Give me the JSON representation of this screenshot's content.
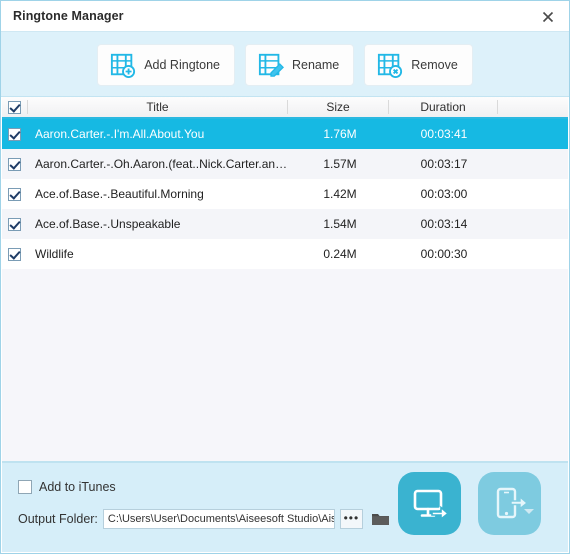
{
  "window": {
    "title": "Ringtone Manager",
    "close_icon": "close-icon"
  },
  "toolbar": {
    "buttons": [
      {
        "label": "Add Ringtone",
        "icon": "film-add-icon"
      },
      {
        "label": "Rename",
        "icon": "film-pencil-icon"
      },
      {
        "label": "Remove",
        "icon": "film-remove-icon"
      }
    ]
  },
  "table": {
    "select_all_checked": true,
    "headers": {
      "title": "Title",
      "size": "Size",
      "duration": "Duration"
    },
    "rows": [
      {
        "checked": true,
        "title": "Aaron.Carter.-.I'm.All.About.You",
        "size": "1.76M",
        "duration": "00:03:41",
        "selected": true
      },
      {
        "checked": true,
        "title": "Aaron.Carter.-.Oh.Aaron.(feat..Nick.Carter.and.No.Sec...",
        "size": "1.57M",
        "duration": "00:03:17",
        "selected": false
      },
      {
        "checked": true,
        "title": "Ace.of.Base.-.Beautiful.Morning",
        "size": "1.42M",
        "duration": "00:03:00",
        "selected": false
      },
      {
        "checked": true,
        "title": "Ace.of.Base.-.Unspeakable",
        "size": "1.54M",
        "duration": "00:03:14",
        "selected": false
      },
      {
        "checked": true,
        "title": "Wildlife",
        "size": "0.24M",
        "duration": "00:00:30",
        "selected": false
      }
    ]
  },
  "bottom": {
    "itunes_label": "Add to iTunes",
    "itunes_checked": false,
    "output_label": "Output Folder:",
    "output_path": "C:\\Users\\User\\Documents\\Aiseesoft Studio\\Aisee",
    "browse_dots": "•••",
    "folder_icon": "folder-icon",
    "export_to_pc_icon": "monitor-export-icon",
    "export_to_device_icon": "device-export-icon"
  },
  "colors": {
    "accent": "#16b9e3",
    "toolbar_bg": "#ddf1fa",
    "panel_bg": "#d6eef9",
    "primary_action": "#3ab3d0",
    "secondary_action": "#7ecbe0"
  }
}
